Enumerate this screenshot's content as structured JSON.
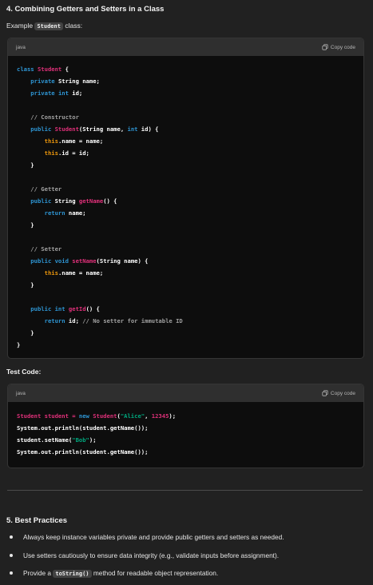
{
  "section4": {
    "heading": "4. Combining Getters and Setters in a Class",
    "intro_prefix": "Example",
    "intro_code": "Student",
    "intro_suffix": " class:"
  },
  "codeblock1": {
    "language": "java",
    "copy_label": "Copy code",
    "lines": [
      [
        {
          "t": "class ",
          "c": "kw"
        },
        {
          "t": "Student",
          "c": "ty"
        },
        {
          "t": " {",
          "c": ""
        }
      ],
      [
        {
          "t": "    private ",
          "c": "kw"
        },
        {
          "t": "String name;",
          "c": ""
        }
      ],
      [
        {
          "t": "    private ",
          "c": "kw"
        },
        {
          "t": "int",
          "c": "kw"
        },
        {
          "t": " id;",
          "c": ""
        }
      ],
      [],
      [
        {
          "t": "    // Constructor",
          "c": "cm"
        }
      ],
      [
        {
          "t": "    public ",
          "c": "kw"
        },
        {
          "t": "Student",
          "c": "ty"
        },
        {
          "t": "(String name, ",
          "c": ""
        },
        {
          "t": "int",
          "c": "kw"
        },
        {
          "t": " id) {",
          "c": ""
        }
      ],
      [
        {
          "t": "        this",
          "c": "th"
        },
        {
          "t": ".name = name;",
          "c": ""
        }
      ],
      [
        {
          "t": "        this",
          "c": "th"
        },
        {
          "t": ".id = id;",
          "c": ""
        }
      ],
      [
        {
          "t": "    }",
          "c": ""
        }
      ],
      [],
      [
        {
          "t": "    // Getter",
          "c": "cm"
        }
      ],
      [
        {
          "t": "    public ",
          "c": "kw"
        },
        {
          "t": "String ",
          "c": ""
        },
        {
          "t": "getName",
          "c": "ty"
        },
        {
          "t": "() {",
          "c": ""
        }
      ],
      [
        {
          "t": "        return ",
          "c": "kw"
        },
        {
          "t": "name;",
          "c": ""
        }
      ],
      [
        {
          "t": "    }",
          "c": ""
        }
      ],
      [],
      [
        {
          "t": "    // Setter",
          "c": "cm"
        }
      ],
      [
        {
          "t": "    public ",
          "c": "kw"
        },
        {
          "t": "void ",
          "c": "kw"
        },
        {
          "t": "setName",
          "c": "ty"
        },
        {
          "t": "(String name) {",
          "c": ""
        }
      ],
      [
        {
          "t": "        this",
          "c": "th"
        },
        {
          "t": ".name = name;",
          "c": ""
        }
      ],
      [
        {
          "t": "    }",
          "c": ""
        }
      ],
      [],
      [
        {
          "t": "    public ",
          "c": "kw"
        },
        {
          "t": "int ",
          "c": "kw"
        },
        {
          "t": "getId",
          "c": "ty"
        },
        {
          "t": "() {",
          "c": ""
        }
      ],
      [
        {
          "t": "        return ",
          "c": "kw"
        },
        {
          "t": "id; ",
          "c": ""
        },
        {
          "t": "// No setter for immutable ID",
          "c": "cm"
        }
      ],
      [
        {
          "t": "    }",
          "c": ""
        }
      ],
      [
        {
          "t": "}",
          "c": ""
        }
      ]
    ]
  },
  "test_code_label": "Test Code:",
  "codeblock2": {
    "language": "java",
    "copy_label": "Copy code",
    "lines": [
      [
        {
          "t": "Student student = ",
          "c": "ty"
        },
        {
          "t": "new ",
          "c": "kw"
        },
        {
          "t": "Student",
          "c": "ty"
        },
        {
          "t": "(",
          "c": ""
        },
        {
          "t": "\"Alice\"",
          "c": "st"
        },
        {
          "t": ", ",
          "c": ""
        },
        {
          "t": "12345",
          "c": "nm"
        },
        {
          "t": ");",
          "c": ""
        }
      ],
      [
        {
          "t": "System.out.println(student.getName());",
          "c": ""
        }
      ],
      [
        {
          "t": "student.setName(",
          "c": ""
        },
        {
          "t": "\"Bob\"",
          "c": "st"
        },
        {
          "t": ");",
          "c": ""
        }
      ],
      [
        {
          "t": "System.out.println(student.getName());",
          "c": ""
        }
      ]
    ]
  },
  "section5": {
    "heading": "5. Best Practices",
    "bullets": [
      {
        "text": "Always keep instance variables private and provide public getters and setters as needed."
      },
      {
        "text": "Use setters cautiously to ensure data integrity (e.g., validate inputs before assignment)."
      },
      {
        "pre": "Provide a ",
        "code": "toString()",
        "post": " method for readable object representation."
      }
    ]
  },
  "colors": {
    "background": "#212121",
    "code_background": "#0d0d0d",
    "code_header": "#2f2f2f",
    "keyword": "#2e95d3",
    "type": "#df3079",
    "comment": "#a0a0a0",
    "this": "#e9950c",
    "string": "#00a67d"
  }
}
